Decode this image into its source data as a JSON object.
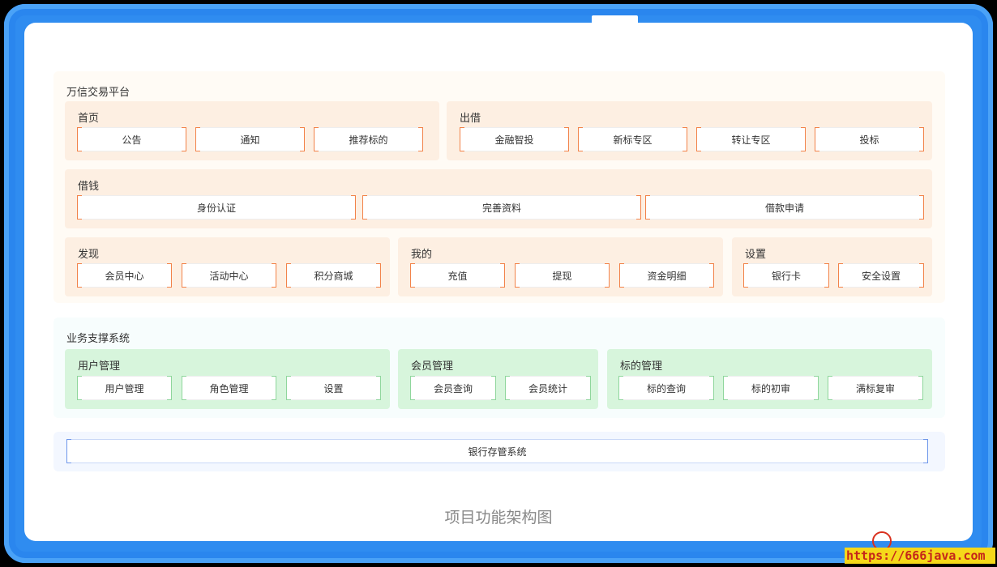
{
  "trading": {
    "title": "万信交易平台",
    "home": {
      "title": "首页",
      "items": [
        "公告",
        "通知",
        "推荐标的"
      ]
    },
    "lend": {
      "title": "出借",
      "items": [
        "金融智投",
        "新标专区",
        "转让专区",
        "投标"
      ]
    },
    "borrow": {
      "title": "借钱",
      "items": [
        "身份认证",
        "完善资料",
        "借款申请"
      ]
    },
    "discover": {
      "title": "发现",
      "items": [
        "会员中心",
        "活动中心",
        "积分商城"
      ]
    },
    "mine": {
      "title": "我的",
      "items": [
        "充值",
        "提现",
        "资金明细"
      ]
    },
    "settings": {
      "title": "设置",
      "items": [
        "银行卡",
        "安全设置"
      ]
    }
  },
  "business": {
    "title": "业务支撑系统",
    "user_mgmt": {
      "title": "用户管理",
      "items": [
        "用户管理",
        "角色管理",
        "设置"
      ]
    },
    "member_mgmt": {
      "title": "会员管理",
      "items": [
        "会员查询",
        "会员统计"
      ]
    },
    "bid_mgmt": {
      "title": "标的管理",
      "items": [
        "标的查询",
        "标的初审",
        "满标复审"
      ]
    }
  },
  "bank": {
    "label": "银行存管系统"
  },
  "caption": "项目功能架构图",
  "watermark": {
    "url": "https://666java.com"
  },
  "colors": {
    "frame": "#2f8cf0",
    "orange_group": "#fdefe2",
    "orange_corner": "#f2834a",
    "green_group": "#d7f5dc",
    "green_corner": "#8fd69c",
    "blue_corner": "#6d96ea"
  }
}
